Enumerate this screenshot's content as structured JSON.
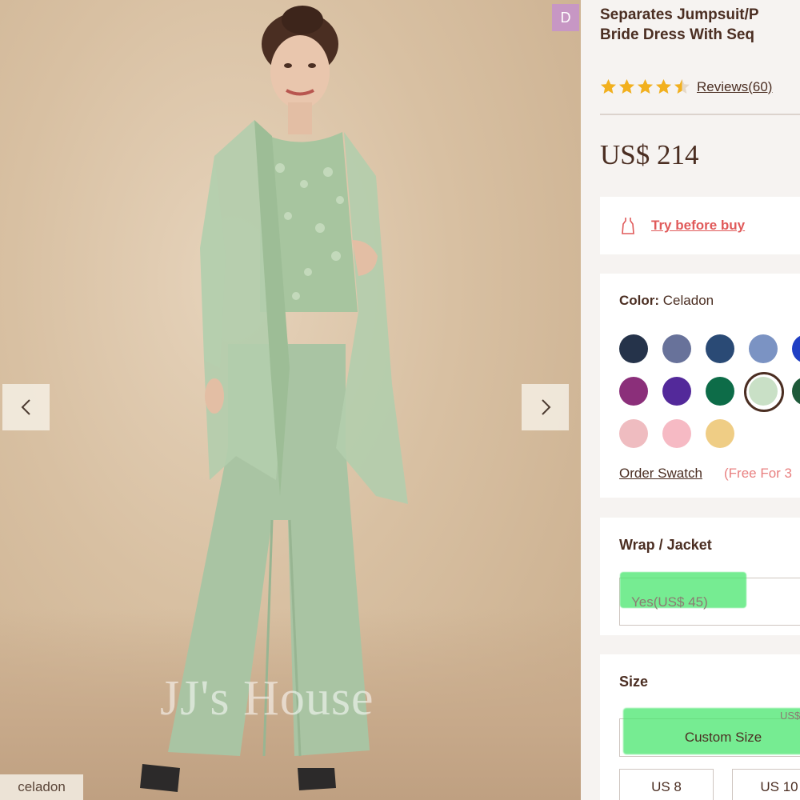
{
  "product": {
    "title_line1": "Separates Jumpsuit/P",
    "title_line2": "Bride Dress With Seq",
    "rating_value": 4.5,
    "reviews_label": "Reviews(60)",
    "price": "US$ 214",
    "badge": "D"
  },
  "gallery": {
    "watermark": "JJ's House",
    "color_tag": "celadon",
    "prev_icon": "chevron-left-icon",
    "next_icon": "chevron-right-icon"
  },
  "try_before_buy": {
    "icon": "dress-icon",
    "label": "Try before buy"
  },
  "color": {
    "label": "Color:",
    "selected": "Celadon",
    "swatches": [
      {
        "name": "dark-navy",
        "hex": "#25334a"
      },
      {
        "name": "slate-blue",
        "hex": "#68729a"
      },
      {
        "name": "ink-blue",
        "hex": "#2a4a75"
      },
      {
        "name": "cornflower",
        "hex": "#7b93c3"
      },
      {
        "name": "royal-blue",
        "hex": "#1f3fc4"
      },
      {
        "name": "plum",
        "hex": "#8b2f7a"
      },
      {
        "name": "regency",
        "hex": "#53299a"
      },
      {
        "name": "dark-green",
        "hex": "#0d6c48"
      },
      {
        "name": "celadon",
        "hex": "#c9e0c6",
        "selected": true
      },
      {
        "name": "hunter",
        "hex": "#1e5a3a"
      },
      {
        "name": "blushing-pink",
        "hex": "#efbcc0"
      },
      {
        "name": "candy-pink",
        "hex": "#f6bac4"
      },
      {
        "name": "daffodil",
        "hex": "#efcd85"
      }
    ],
    "order_swatch": "Order Swatch",
    "free_note": "(Free For 3"
  },
  "wrap": {
    "label": "Wrap / Jacket",
    "value": "Yes(US$ 45)"
  },
  "size": {
    "label": "Size",
    "us_hint": "US$",
    "selected": "Custom Size",
    "options": [
      "US 8",
      "US 10"
    ]
  },
  "colors": {
    "title": "#4b2e22",
    "accent_link": "#e05a5a",
    "highlight": "#48e66e",
    "star": "#f2b01e"
  }
}
